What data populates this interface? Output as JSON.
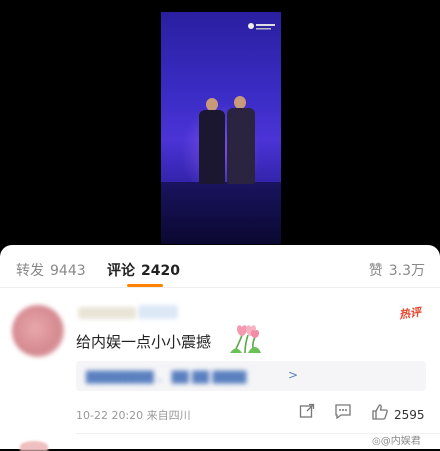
{
  "tabs": {
    "repost_label": "转发",
    "repost_count": "9443",
    "comments_label": "评论",
    "comments_count": "2420",
    "likes_label": "赞",
    "likes_count": "3.3万"
  },
  "colors": {
    "accent": "#ff8200",
    "hot": "#e8462c",
    "link": "#5a80c0"
  },
  "comment": {
    "badge": "热评",
    "text": "给内娱一点小小震撼",
    "repost_arrow": ">",
    "timestamp": "10-22 20:20",
    "location": "来自四川",
    "like_count": "2595"
  },
  "watermark": "@内娱君"
}
